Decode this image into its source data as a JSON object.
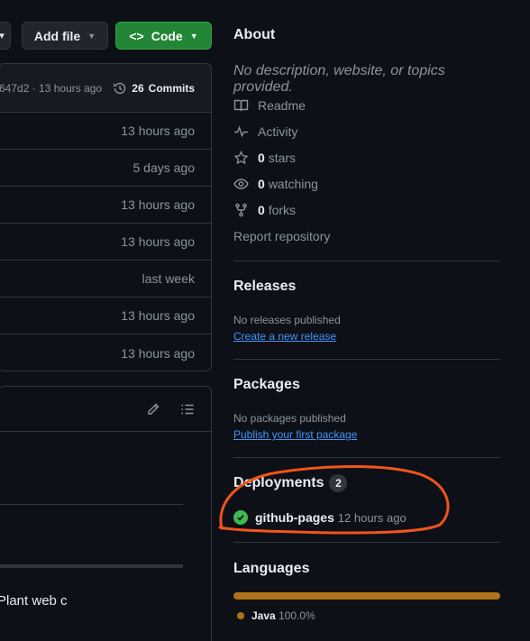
{
  "toolbar": {
    "add_file_label": "Add file",
    "code_label": "Code",
    "code_icon": "<>"
  },
  "file_box": {
    "commit_hash": "647d2 · 13 hours ago",
    "commits_count": "26",
    "commits_label": "Commits",
    "rows": [
      "13 hours ago",
      "5 days ago",
      "13 hours ago",
      "13 hours ago",
      "last week",
      "13 hours ago",
      "13 hours ago"
    ]
  },
  "readme": {
    "snippet": "Plant web c"
  },
  "about": {
    "title": "About",
    "description": "No description, website, or topics provided.",
    "readme_label": "Readme",
    "activity_label": "Activity",
    "stars_count": "0",
    "stars_label": "stars",
    "watching_count": "0",
    "watching_label": "watching",
    "forks_count": "0",
    "forks_label": "forks",
    "report_label": "Report repository"
  },
  "releases": {
    "title": "Releases",
    "empty_text": "No releases published",
    "create_link": "Create a new release"
  },
  "packages": {
    "title": "Packages",
    "empty_text": "No packages published",
    "publish_link": "Publish your first package"
  },
  "deployments": {
    "title": "Deployments",
    "count": "2",
    "name": "github-pages",
    "time": "12 hours ago"
  },
  "languages": {
    "title": "Languages",
    "items": [
      {
        "name": "Java",
        "percent": "100.0%",
        "color": "#b07219"
      }
    ]
  },
  "colors": {
    "annotation": "#f2541b",
    "success": "#3fb950",
    "link": "#4493f8"
  }
}
